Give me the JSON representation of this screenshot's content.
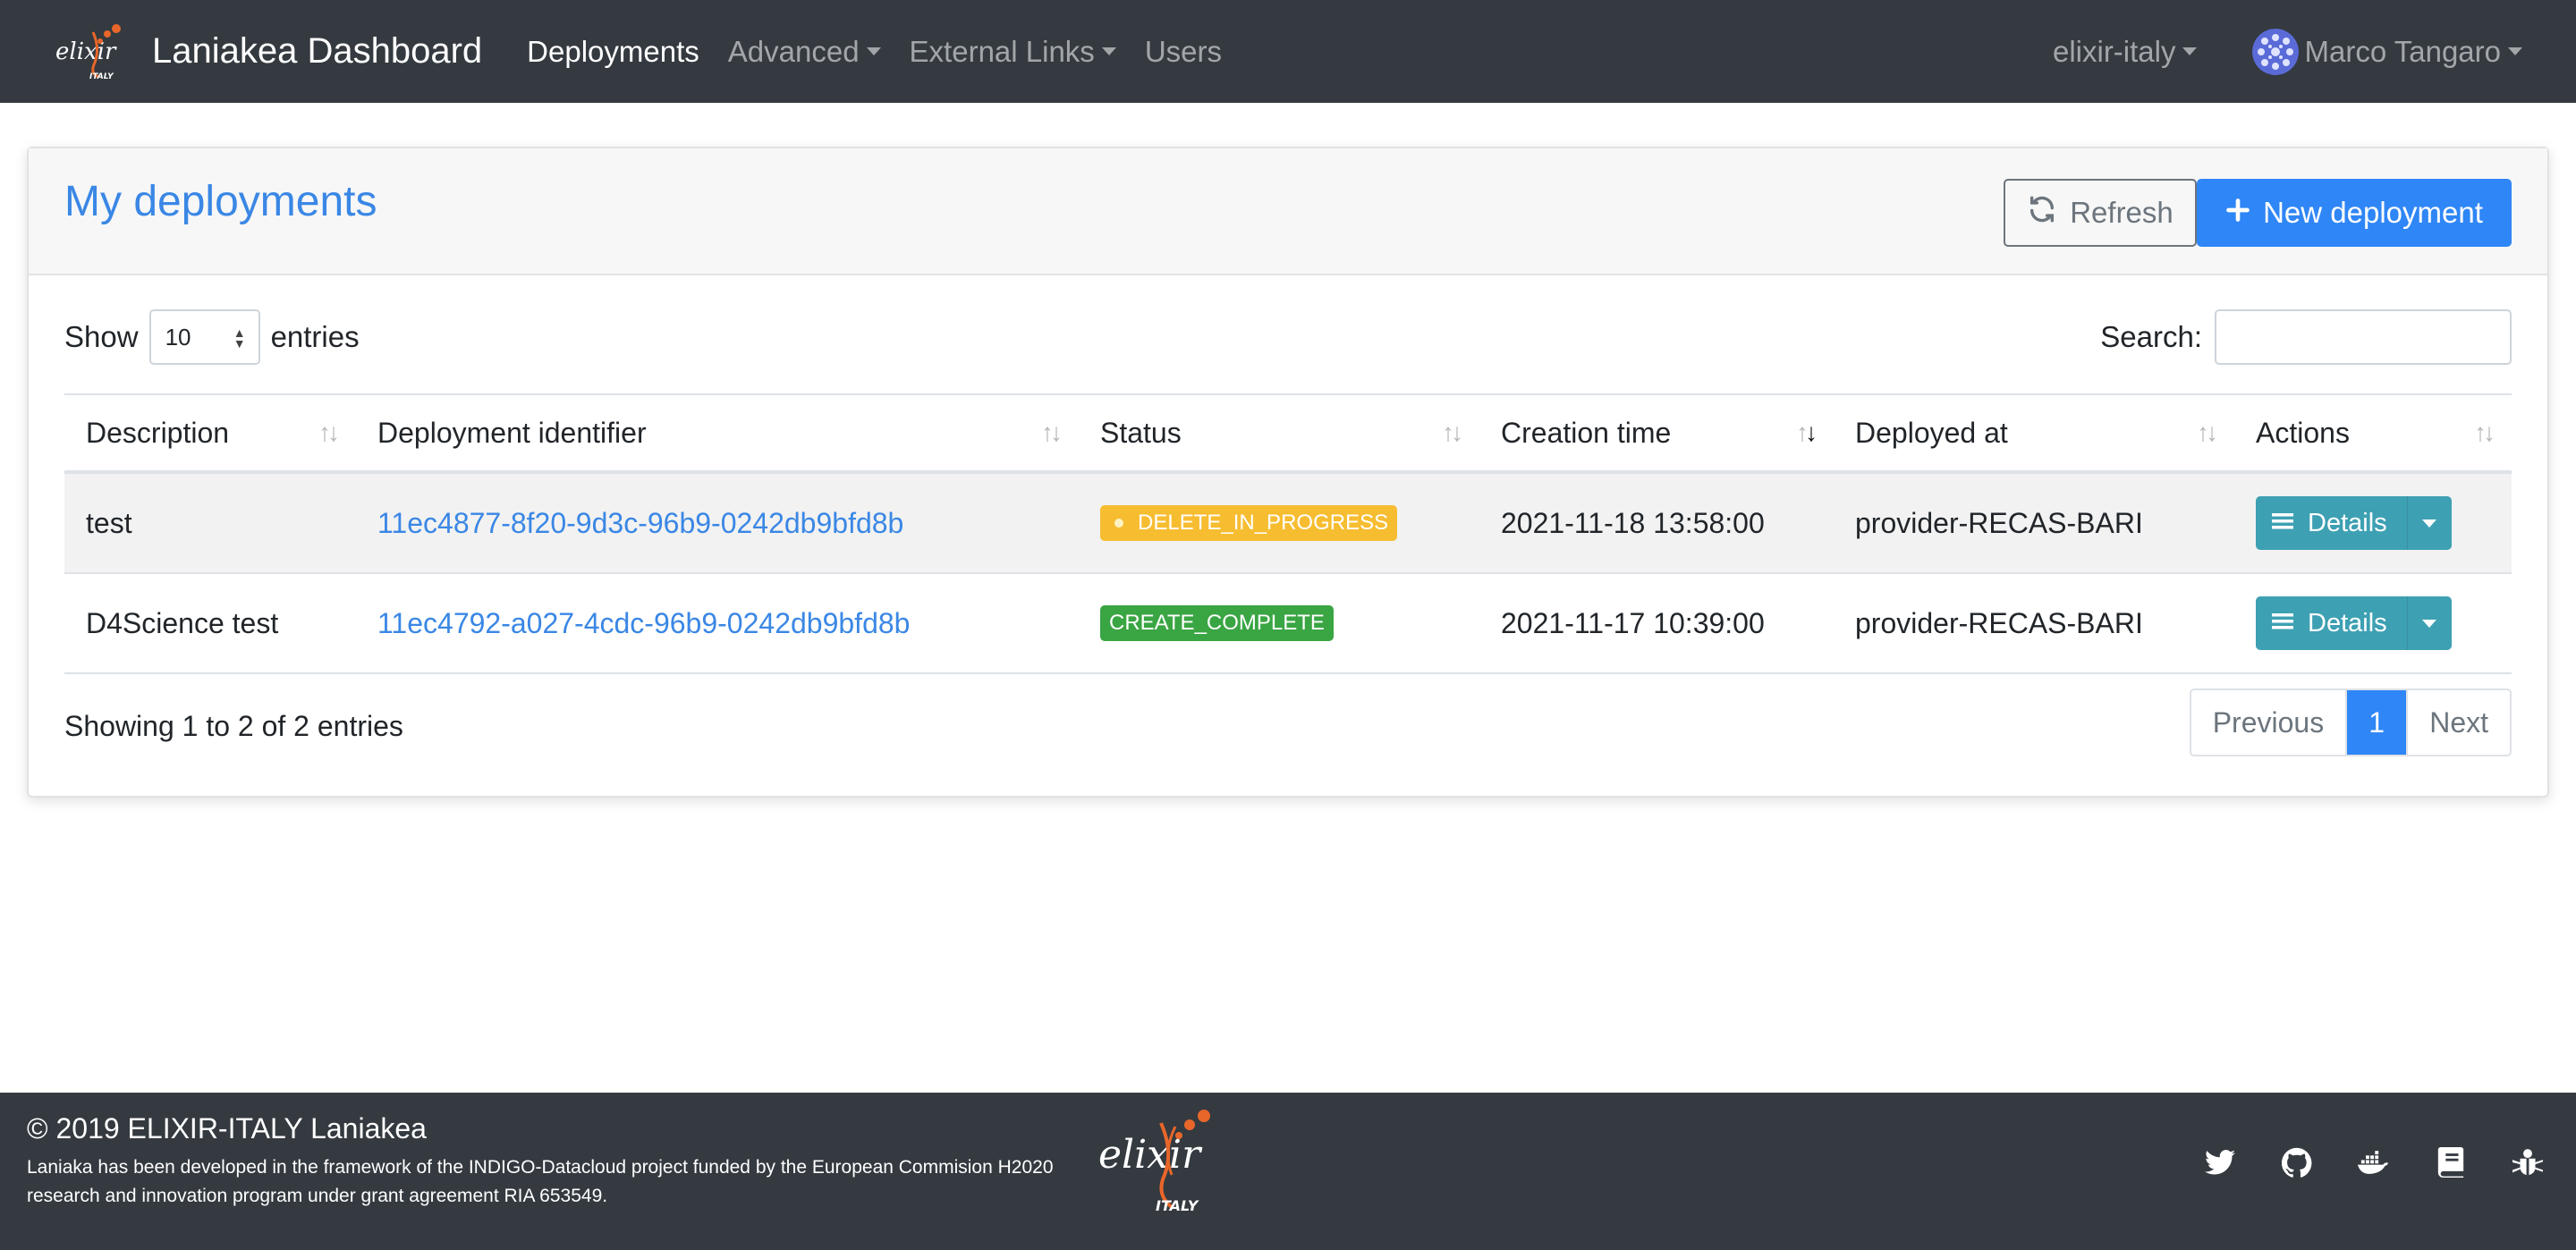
{
  "navbar": {
    "logo_text": "elixir",
    "logo_sub": "ITALY",
    "brand": "Laniakea Dashboard",
    "links": [
      {
        "label": "Deployments",
        "active": true
      },
      {
        "label": "Advanced",
        "dropdown": true
      },
      {
        "label": "External Links",
        "dropdown": true
      },
      {
        "label": "Users"
      }
    ],
    "group": "elixir-italy",
    "user": "Marco Tangaro"
  },
  "card": {
    "title": "My deployments",
    "refresh_label": "Refresh",
    "new_label": "New deployment"
  },
  "controls": {
    "show_label": "Show",
    "entries_label": "entries",
    "length_value": "10",
    "search_label": "Search:",
    "search_value": ""
  },
  "table": {
    "columns": [
      "Description",
      "Deployment identifier",
      "Status",
      "Creation time",
      "Deployed at",
      "Actions"
    ],
    "sorted_column": "Creation time",
    "rows": [
      {
        "description": "test",
        "identifier": "11ec4877-8f20-9d3c-96b9-0242db9bfd8b",
        "status": "DELETE_IN_PROGRESS",
        "created": "2021-11-18 13:58:00",
        "deployed_at": "provider-RECAS-BARI",
        "action": "Details"
      },
      {
        "description": "D4Science test",
        "identifier": "11ec4792-a027-4cdc-96b9-0242db9bfd8b",
        "status": "CREATE_COMPLETE",
        "created": "2021-11-17 10:39:00",
        "deployed_at": "provider-RECAS-BARI",
        "action": "Details"
      }
    ]
  },
  "info": "Showing 1 to 2 of 2 entries",
  "pager": {
    "previous": "Previous",
    "current": "1",
    "next": "Next"
  },
  "footer": {
    "title": "© 2019 ELIXIR-ITALY Laniakea",
    "text": "Laniaka has been developed in the framework of the INDIGO-Datacloud project funded by the European Commision H2020 research and innovation program under grant agreement RIA 653549.",
    "logo_text": "elixir",
    "logo_sub": "ITALY",
    "icons": [
      "twitter-icon",
      "github-icon",
      "docker-icon",
      "book-icon",
      "bug-icon"
    ]
  },
  "colors": {
    "navbar": "#343a40",
    "primary": "#2f86f6",
    "link": "#3a87e5",
    "warning": "#f7bd31",
    "success": "#3aa543",
    "info": "#3ea0b3",
    "logo_orange": "#e8662a"
  }
}
